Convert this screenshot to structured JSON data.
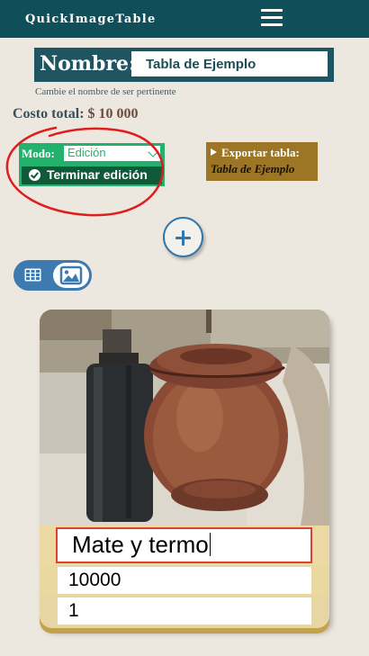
{
  "header": {
    "brand": "QuickImageTable",
    "menu_icon": "hamburger-icon"
  },
  "table_name": {
    "label": "Nombre:",
    "value": "Tabla de Ejemplo",
    "hint": "Cambie el nombre de ser pertinente"
  },
  "total": {
    "label": "Costo total:",
    "amount": "$ 10 000"
  },
  "mode": {
    "label": "Modo:",
    "selected": "Edición",
    "finish_label": "Terminar edición"
  },
  "export": {
    "label": "Exportar tabla:",
    "name": "Tabla de Ejemplo"
  },
  "view_toggle": {
    "table_icon": "grid-icon",
    "image_icon": "image-icon",
    "active": "image"
  },
  "card": {
    "title": "Mate y termo",
    "cost": "10000",
    "quantity": "1"
  },
  "colors": {
    "header": "#0f4f5a",
    "mode_green": "#22b26d",
    "export_gold": "#9c7525",
    "accent_blue": "#2f77ae",
    "card_bg": "#ecd9a3",
    "annotation_red": "#e01c1c"
  }
}
